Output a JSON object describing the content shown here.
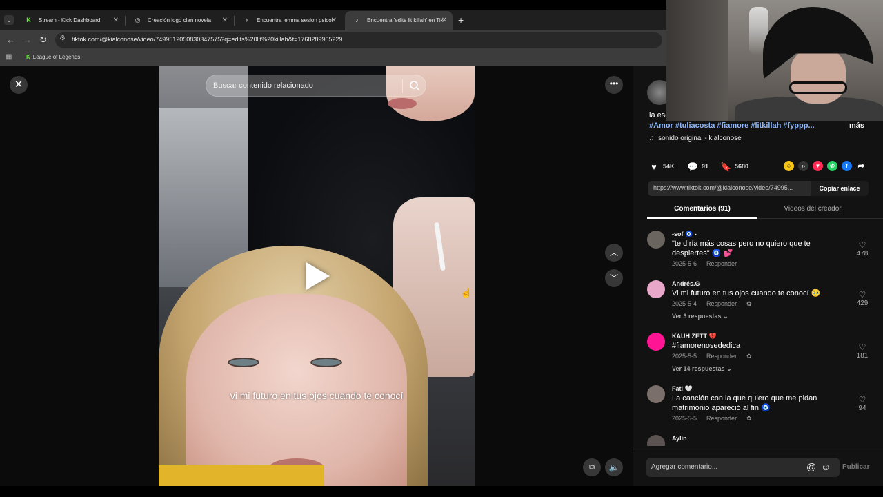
{
  "browser": {
    "tabs": [
      {
        "label": "Stream - Kick Dashboard",
        "favicon": "K",
        "favicon_color": "#53fc18"
      },
      {
        "label": "Creación logo clan novela",
        "favicon": "◎",
        "favicon_color": "#dddddd"
      },
      {
        "label": "Encuentra 'emma sesion psicol",
        "favicon": "♪",
        "favicon_color": "#ffffff"
      },
      {
        "label": "Encuentra 'edits lit killah' en Tik",
        "favicon": "♪",
        "favicon_color": "#ffffff"
      }
    ],
    "new_tab": "+",
    "url": "tiktok.com/@kialconose/video/7499512050830347575?q=edits%20lit%20killah&t=1768289965229",
    "bookmark": "League of Legends"
  },
  "video": {
    "search_placeholder": "Buscar contenido relacionado",
    "caption": "vi mi futuro en tus ojos cuando te conocí"
  },
  "post": {
    "description": "la esc",
    "hashtags": "#Amor #tuliacosta #fiamore #litkillah #fyppp...",
    "more_label": "más",
    "sound": "sonido original - kialconose",
    "likes": "54K",
    "comments": "91",
    "saves": "5680",
    "link": "https://www.tiktok.com/@kialconose/video/74995...",
    "copy_label": "Copiar enlace"
  },
  "tabs": {
    "comments": "Comentarios (91)",
    "creator_videos": "Videos del creador"
  },
  "comments": [
    {
      "user": "-sof 🧿 -",
      "text": "\"te diría más cosas pero no quiero que te despiertes\" 🧿 💕",
      "date": "2025-5-6",
      "reply": "Responder",
      "likes": "478",
      "avatar_color": "#6b6560"
    },
    {
      "user": "Andrés.G",
      "text": "Vi mi futuro en tus ojos cuando te conocí 🥹",
      "date": "2025-5-4",
      "reply": "Responder",
      "likes": "429",
      "more_replies": "Ver 3 respuestas",
      "avatar_color": "#e8a6c8"
    },
    {
      "user": "KAUH ZETT 💔",
      "text": "#fiamorenosededica",
      "date": "2025-5-5",
      "reply": "Responder",
      "likes": "181",
      "more_replies": "Ver 14 respuestas",
      "avatar_color": "#ff1493"
    },
    {
      "user": "Fati 🤍",
      "text": "La canción con la que quiero que me pidan matrimonio apareció al fin 🧿",
      "date": "2025-5-5",
      "reply": "Responder",
      "likes": "94",
      "avatar_color": "#7a6f6a"
    },
    {
      "user": "Aylin",
      "text": "",
      "date": "",
      "reply": "",
      "likes": "",
      "avatar_color": "#5a5352"
    }
  ],
  "composer": {
    "placeholder": "Agregar comentario...",
    "publish": "Publicar"
  }
}
